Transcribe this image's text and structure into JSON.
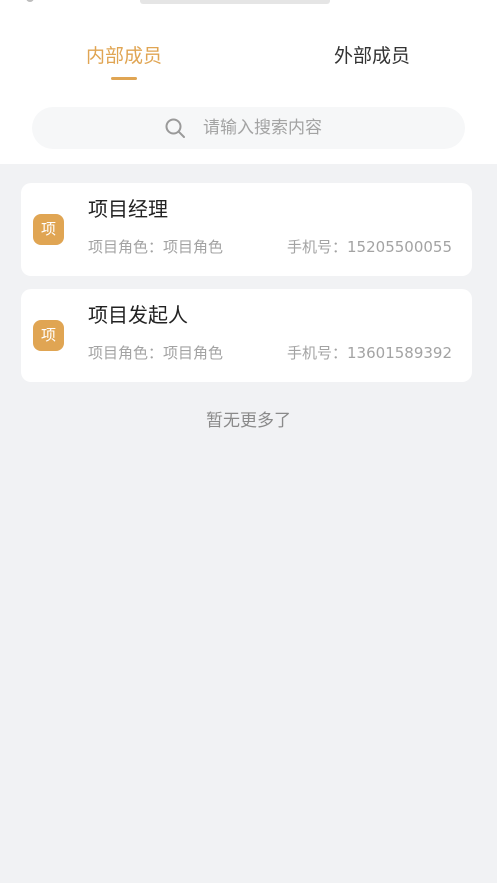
{
  "tabs": {
    "internal_label": "内部成员",
    "external_label": "外部成员",
    "active": "internal"
  },
  "search": {
    "placeholder": "请输入搜索内容",
    "icon": "search-icon"
  },
  "members": [
    {
      "badge": "项",
      "name": "项目经理",
      "role_label": "项目角色：",
      "role_value": "项目角色",
      "phone_label": "手机号：",
      "phone_value": "15205500055"
    },
    {
      "badge": "项",
      "name": "项目发起人",
      "role_label": "项目角色：",
      "role_value": "项目角色",
      "phone_label": "手机号：",
      "phone_value": "13601589392"
    }
  ],
  "footer": {
    "no_more_text": "暂无更多了"
  },
  "colors": {
    "accent": "#e0a553",
    "background": "#f1f2f4",
    "card": "#ffffff",
    "secondary_text": "#a3a3a3"
  }
}
